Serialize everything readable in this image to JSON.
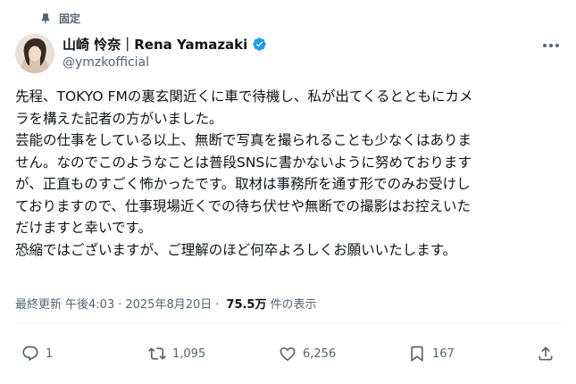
{
  "pinned": {
    "label": "固定",
    "icon": "pin-icon"
  },
  "author": {
    "display_name": "山崎 怜奈｜Rena Yamazaki",
    "handle": "@ymzkofficial",
    "verified": true,
    "verified_color": "#1d9bf0"
  },
  "tweet": {
    "lines": [
      "先程、TOKYO FMの裏玄関近くに車で待機し、私が出てくるとともにカメ",
      "ラを構えた記者の方がいました。",
      "芸能の仕事をしている以上、無断で写真を撮られることも少なくはありま",
      "せん。なのでこのようなことは普段SNSに書かないように努めております",
      "が、正直ものすごく怖かったです。取材は事務所を通す形でのみお受けし",
      "ておりますので、仕事現場近くでの待ち伏せや無断での撮影はお控えいた",
      "だけますと幸いです。",
      "恐縮ではございますが、ご理解のほど何卒よろしくお願いいたします。"
    ]
  },
  "meta": {
    "updated_label": "最終更新",
    "time": "午後4:03",
    "separator": "·",
    "date": "2025年8月20日",
    "views": "75.5万",
    "views_label": "件の表示"
  },
  "actions": {
    "reply": {
      "count": "1",
      "icon": "reply-icon"
    },
    "repost": {
      "count": "1,095",
      "icon": "repost-icon"
    },
    "like": {
      "count": "6,256",
      "icon": "heart-icon"
    },
    "bookmark": {
      "count": "167",
      "icon": "bookmark-icon"
    },
    "share": {
      "icon": "share-icon"
    }
  },
  "colors": {
    "text": "#0f1419",
    "secondary": "#536471",
    "divider": "#eff3f4"
  }
}
